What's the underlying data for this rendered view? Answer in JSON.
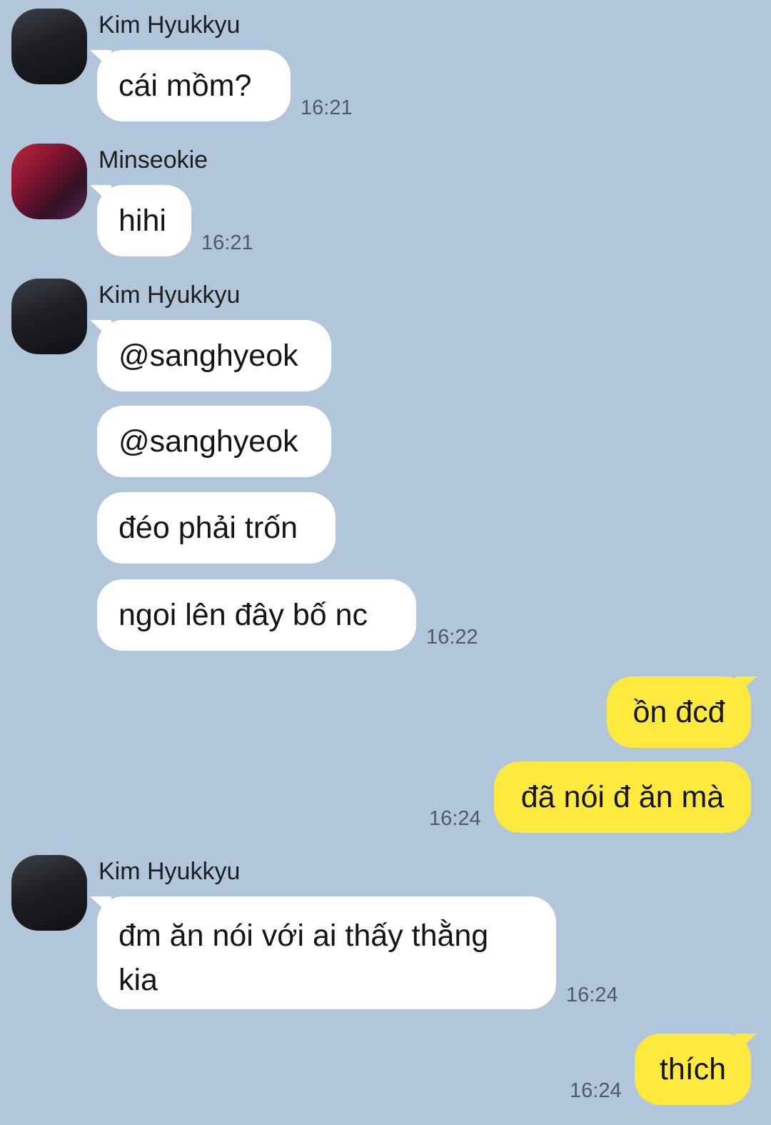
{
  "messages": [
    {
      "sender": "Kim Hyukkyu",
      "text": "cái mồm?",
      "time": "16:21"
    },
    {
      "sender": "Minseokie",
      "text": "hihi",
      "time": "16:21"
    },
    {
      "sender": "Kim Hyukkyu",
      "text_1": "@sanghyeok",
      "text_2": "@sanghyeok",
      "text_3": "đéo phải trốn",
      "text_4": "ngoi lên đây bố nc",
      "time": "16:22"
    },
    {
      "from_me": true,
      "text_1": "ồn đcđ",
      "text_2": "đã nói đ ăn mà",
      "time": "16:24"
    },
    {
      "sender": "Kim Hyukkyu",
      "text": "đm ăn nói với ai thấy thằng kia",
      "time": "16:24"
    },
    {
      "from_me": true,
      "text": "thích",
      "time": "16:24"
    }
  ],
  "colors": {
    "background": "#b1c6da",
    "incoming_bubble": "#ffffff",
    "outgoing_bubble": "#fee93f",
    "timestamp": "#4f5a66"
  }
}
